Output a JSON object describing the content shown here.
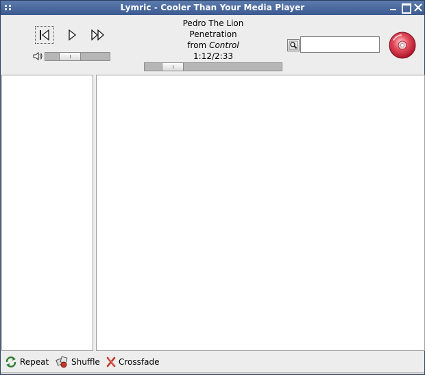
{
  "window": {
    "title": "Lymric - Cooler Than Your Media Player"
  },
  "player": {
    "artist": "Pedro The Lion",
    "track": "Penetration",
    "from_label": "from",
    "album": "Control",
    "time": "1:12/2:33",
    "seek_position": 0.15,
    "volume_level": 0.33
  },
  "search": {
    "value": "",
    "placeholder": ""
  },
  "toggles": {
    "repeat": "Repeat",
    "shuffle": "Shuffle",
    "crossfade": "Crossfade"
  },
  "icons": {
    "menu": "window-menu-icon",
    "minimize": "minimize-icon",
    "maximize": "maximize-icon",
    "close": "close-icon",
    "previous": "previous-track-icon",
    "play": "play-icon",
    "next": "next-track-icon",
    "volume": "speaker-icon",
    "search": "search-icon",
    "cd": "cd-disc-icon",
    "repeat": "repeat-icon",
    "shuffle": "shuffle-icon",
    "crossfade": "crossfade-icon"
  },
  "colors": {
    "titlebar": "#3c5a90",
    "window_bg": "#ededed",
    "cd_red": "#d42a3e",
    "crossfade_red": "#c0392b"
  }
}
